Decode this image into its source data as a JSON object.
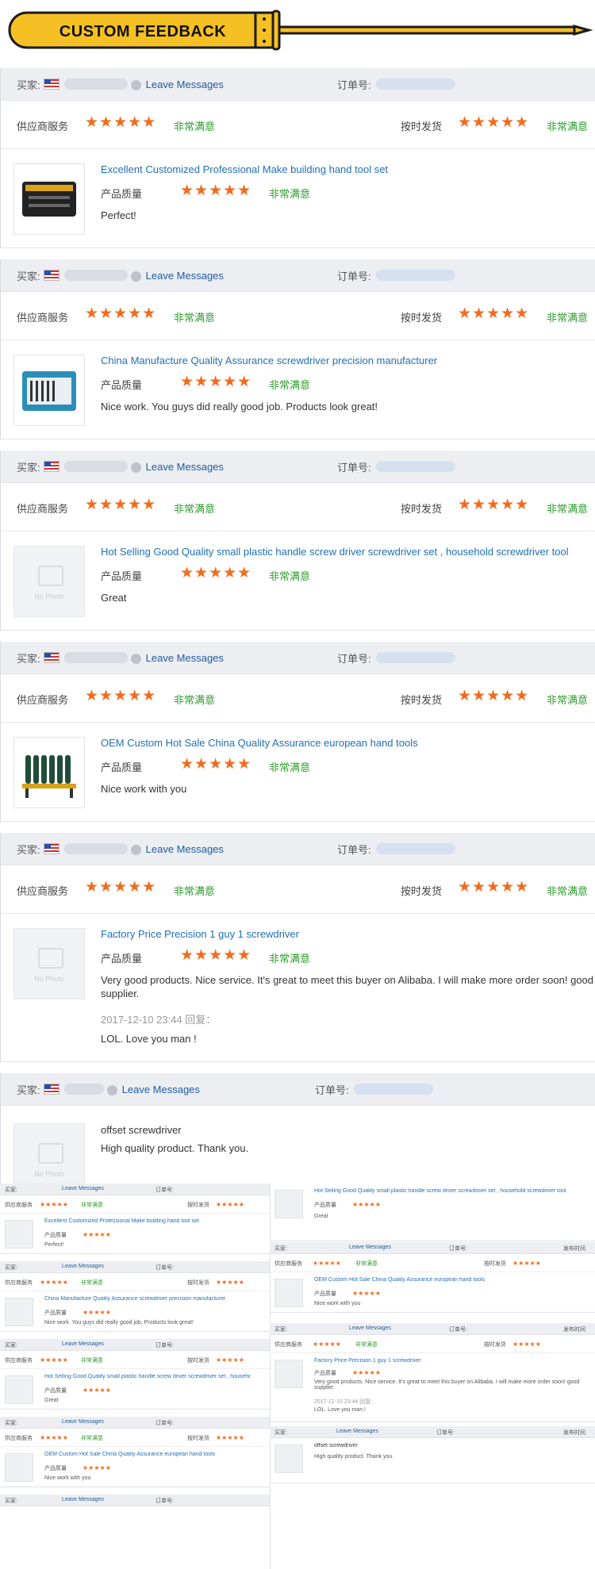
{
  "banner": {
    "title": "CUSTOM FEEDBACK",
    "color": "#f5c023"
  },
  "labels": {
    "buyer": "买家:",
    "leave_messages": "Leave Messages",
    "order_no": "订单号:",
    "supplier_service": "供应商服务",
    "on_time_delivery": "按时发货",
    "product_quality": "产品质量",
    "very_satisfied": "非常满意",
    "stars": "★★★★★",
    "no_photo": "No Photo",
    "publish_time": "发布时间"
  },
  "colors": {
    "star": "#f26b1d",
    "satisfied": "#2e9c2e",
    "link": "#1f6fb8",
    "header_bg": "#eceef2"
  },
  "reviews": [
    {
      "title": "Excellent Customized Professional Make building hand tool set",
      "comment": "Perfect!",
      "thumb": "tool-case-icon"
    },
    {
      "title": "China Manufacture Quality Assurance screwdriver precision manufacturer",
      "comment": "Nice work. You guys did really good job. Products look great!",
      "thumb": "screwdriver-kit-icon"
    },
    {
      "title": "Hot Selling Good Quality small plastic handle screw driver screwdriver set , household screwdriver tool",
      "comment": "Great",
      "thumb": "no-photo-icon"
    },
    {
      "title": "OEM Custom Hot Sale China Quality Assurance european hand tools",
      "comment": "Nice work with you",
      "thumb": "screwdriver-rack-icon"
    },
    {
      "title": "Factory Price Precision 1 guy 1 screwdriver",
      "comment": "Very good products. Nice service. It's great to meet this buyer on Alibaba. I will make more order soon! good supplier.",
      "reply_time": "2017-12-10 23:44  回复：",
      "reply": "LOL. Love you man !",
      "thumb": "no-photo-icon"
    },
    {
      "title": "offset screwdriver",
      "comment": "High quality product. Thank you.",
      "thumb": "no-photo-icon"
    }
  ]
}
